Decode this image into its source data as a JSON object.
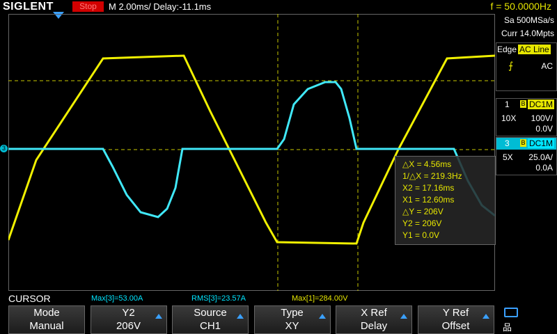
{
  "header": {
    "brand": "SIGLENT",
    "run_state": "Stop",
    "timebase": "M 2.00ms/ Delay:-11.1ms",
    "frequency": "f = 50.0000Hz"
  },
  "acquisition": {
    "sample_rate": "Sa 500MSa/s",
    "memory": "Curr 14.0Mpts"
  },
  "trigger": {
    "label": "Edge",
    "source": "AC Line",
    "coupling": "AC"
  },
  "channels": [
    {
      "num": "1",
      "badge": "B",
      "coupling": "DC1M",
      "probe": "10X",
      "scale": "100V/",
      "offset": "0.0V",
      "color": "#e6e600"
    },
    {
      "num": "3",
      "badge": "B",
      "coupling": "DC1M",
      "probe": "5X",
      "scale": "25.0A/",
      "offset": "0.0A",
      "color": "#00e5ff"
    }
  ],
  "cursor_readout": {
    "dx": "△X = 4.56ms",
    "inv_dx": "1/△X = 219.3Hz",
    "x2": "X2 = 17.16ms",
    "x1": "X1 = 12.60ms",
    "dy": "△Y = 206V",
    "y2": "Y2 = 206V",
    "y1": "Y1 = 0.0V"
  },
  "ground_marker": "3",
  "status": {
    "mode_label": "CURSOR",
    "meas1": "Max[3]=53.00A",
    "meas2": "RMS[3]=23.57A",
    "meas3": "Max[1]=284.00V"
  },
  "softkeys": [
    {
      "top": "Mode",
      "bottom": "Manual",
      "arrow": false
    },
    {
      "top": "Y2",
      "bottom": "206V",
      "arrow": true
    },
    {
      "top": "Source",
      "bottom": "CH1",
      "arrow": true
    },
    {
      "top": "Type",
      "bottom": "XY",
      "arrow": true
    },
    {
      "top": "X Ref",
      "bottom": "Delay",
      "arrow": true
    },
    {
      "top": "Y Ref",
      "bottom": "Offset",
      "arrow": true
    }
  ],
  "colors": {
    "ch1": "#e6e600",
    "ch3": "#00e5ff",
    "accent": "#3aa0ff",
    "stop": "#d10000"
  }
}
